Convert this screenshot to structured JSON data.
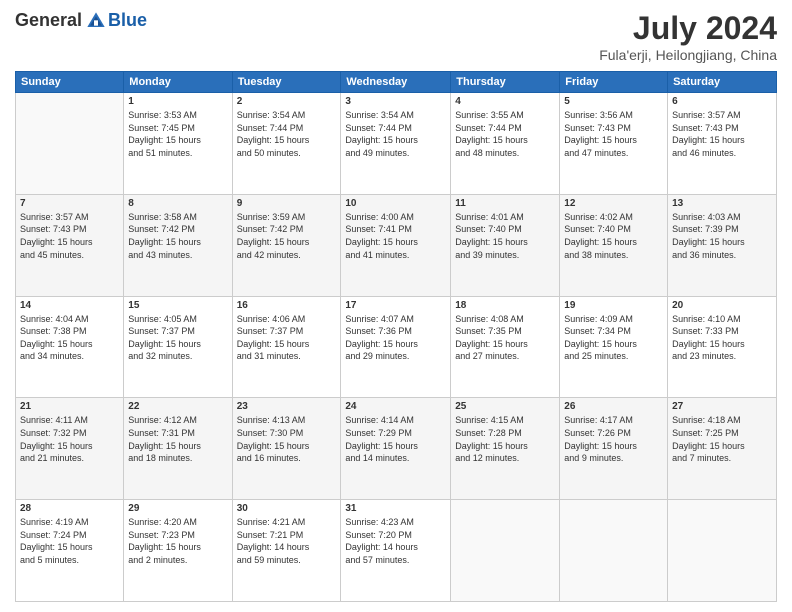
{
  "header": {
    "logo_general": "General",
    "logo_blue": "Blue",
    "month_year": "July 2024",
    "location": "Fula'erji, Heilongjiang, China"
  },
  "weekdays": [
    "Sunday",
    "Monday",
    "Tuesday",
    "Wednesday",
    "Thursday",
    "Friday",
    "Saturday"
  ],
  "weeks": [
    [
      {
        "day": "",
        "info": ""
      },
      {
        "day": "1",
        "info": "Sunrise: 3:53 AM\nSunset: 7:45 PM\nDaylight: 15 hours\nand 51 minutes."
      },
      {
        "day": "2",
        "info": "Sunrise: 3:54 AM\nSunset: 7:44 PM\nDaylight: 15 hours\nand 50 minutes."
      },
      {
        "day": "3",
        "info": "Sunrise: 3:54 AM\nSunset: 7:44 PM\nDaylight: 15 hours\nand 49 minutes."
      },
      {
        "day": "4",
        "info": "Sunrise: 3:55 AM\nSunset: 7:44 PM\nDaylight: 15 hours\nand 48 minutes."
      },
      {
        "day": "5",
        "info": "Sunrise: 3:56 AM\nSunset: 7:43 PM\nDaylight: 15 hours\nand 47 minutes."
      },
      {
        "day": "6",
        "info": "Sunrise: 3:57 AM\nSunset: 7:43 PM\nDaylight: 15 hours\nand 46 minutes."
      }
    ],
    [
      {
        "day": "7",
        "info": "Sunrise: 3:57 AM\nSunset: 7:43 PM\nDaylight: 15 hours\nand 45 minutes."
      },
      {
        "day": "8",
        "info": "Sunrise: 3:58 AM\nSunset: 7:42 PM\nDaylight: 15 hours\nand 43 minutes."
      },
      {
        "day": "9",
        "info": "Sunrise: 3:59 AM\nSunset: 7:42 PM\nDaylight: 15 hours\nand 42 minutes."
      },
      {
        "day": "10",
        "info": "Sunrise: 4:00 AM\nSunset: 7:41 PM\nDaylight: 15 hours\nand 41 minutes."
      },
      {
        "day": "11",
        "info": "Sunrise: 4:01 AM\nSunset: 7:40 PM\nDaylight: 15 hours\nand 39 minutes."
      },
      {
        "day": "12",
        "info": "Sunrise: 4:02 AM\nSunset: 7:40 PM\nDaylight: 15 hours\nand 38 minutes."
      },
      {
        "day": "13",
        "info": "Sunrise: 4:03 AM\nSunset: 7:39 PM\nDaylight: 15 hours\nand 36 minutes."
      }
    ],
    [
      {
        "day": "14",
        "info": "Sunrise: 4:04 AM\nSunset: 7:38 PM\nDaylight: 15 hours\nand 34 minutes."
      },
      {
        "day": "15",
        "info": "Sunrise: 4:05 AM\nSunset: 7:37 PM\nDaylight: 15 hours\nand 32 minutes."
      },
      {
        "day": "16",
        "info": "Sunrise: 4:06 AM\nSunset: 7:37 PM\nDaylight: 15 hours\nand 31 minutes."
      },
      {
        "day": "17",
        "info": "Sunrise: 4:07 AM\nSunset: 7:36 PM\nDaylight: 15 hours\nand 29 minutes."
      },
      {
        "day": "18",
        "info": "Sunrise: 4:08 AM\nSunset: 7:35 PM\nDaylight: 15 hours\nand 27 minutes."
      },
      {
        "day": "19",
        "info": "Sunrise: 4:09 AM\nSunset: 7:34 PM\nDaylight: 15 hours\nand 25 minutes."
      },
      {
        "day": "20",
        "info": "Sunrise: 4:10 AM\nSunset: 7:33 PM\nDaylight: 15 hours\nand 23 minutes."
      }
    ],
    [
      {
        "day": "21",
        "info": "Sunrise: 4:11 AM\nSunset: 7:32 PM\nDaylight: 15 hours\nand 21 minutes."
      },
      {
        "day": "22",
        "info": "Sunrise: 4:12 AM\nSunset: 7:31 PM\nDaylight: 15 hours\nand 18 minutes."
      },
      {
        "day": "23",
        "info": "Sunrise: 4:13 AM\nSunset: 7:30 PM\nDaylight: 15 hours\nand 16 minutes."
      },
      {
        "day": "24",
        "info": "Sunrise: 4:14 AM\nSunset: 7:29 PM\nDaylight: 15 hours\nand 14 minutes."
      },
      {
        "day": "25",
        "info": "Sunrise: 4:15 AM\nSunset: 7:28 PM\nDaylight: 15 hours\nand 12 minutes."
      },
      {
        "day": "26",
        "info": "Sunrise: 4:17 AM\nSunset: 7:26 PM\nDaylight: 15 hours\nand 9 minutes."
      },
      {
        "day": "27",
        "info": "Sunrise: 4:18 AM\nSunset: 7:25 PM\nDaylight: 15 hours\nand 7 minutes."
      }
    ],
    [
      {
        "day": "28",
        "info": "Sunrise: 4:19 AM\nSunset: 7:24 PM\nDaylight: 15 hours\nand 5 minutes."
      },
      {
        "day": "29",
        "info": "Sunrise: 4:20 AM\nSunset: 7:23 PM\nDaylight: 15 hours\nand 2 minutes."
      },
      {
        "day": "30",
        "info": "Sunrise: 4:21 AM\nSunset: 7:21 PM\nDaylight: 14 hours\nand 59 minutes."
      },
      {
        "day": "31",
        "info": "Sunrise: 4:23 AM\nSunset: 7:20 PM\nDaylight: 14 hours\nand 57 minutes."
      },
      {
        "day": "",
        "info": ""
      },
      {
        "day": "",
        "info": ""
      },
      {
        "day": "",
        "info": ""
      }
    ]
  ]
}
